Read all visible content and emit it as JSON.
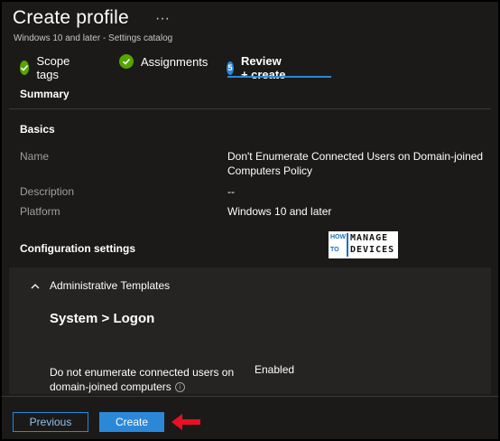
{
  "header": {
    "title": "Create profile",
    "more": "···",
    "subtitle": "Windows 10 and later - Settings catalog"
  },
  "tabs": [
    {
      "label": "Scope tags",
      "state": "complete",
      "icon": "checkmark-icon"
    },
    {
      "label": "Assignments",
      "state": "complete",
      "icon": "checkmark-icon"
    },
    {
      "label": "Review + create",
      "state": "active",
      "step": "5"
    }
  ],
  "summary": {
    "heading": "Summary",
    "basics_heading": "Basics",
    "name_label": "Name",
    "name_value_line1": "Don't Enumerate Connected Users on Domain-joined",
    "name_value_line2": "Computers Policy",
    "description_label": "Description",
    "description_value": "--",
    "platform_label": "Platform",
    "platform_value": "Windows 10 and later"
  },
  "config": {
    "heading": "Configuration settings",
    "category": "Administrative Templates",
    "path": "System > Logon",
    "setting_line1": "Do not enumerate connected users on",
    "setting_line2": "domain-joined computers",
    "setting_value": "Enabled"
  },
  "logo": {
    "how": "HOW",
    "to": "TO",
    "manage": "MANAGE",
    "devices": "DEVICES"
  },
  "footer": {
    "previous_label": "Previous",
    "create_label": "Create"
  },
  "colors": {
    "accent": "#2b88d8",
    "success": "#57a300",
    "arrow": "#e81123",
    "background": "#1b1a19"
  }
}
